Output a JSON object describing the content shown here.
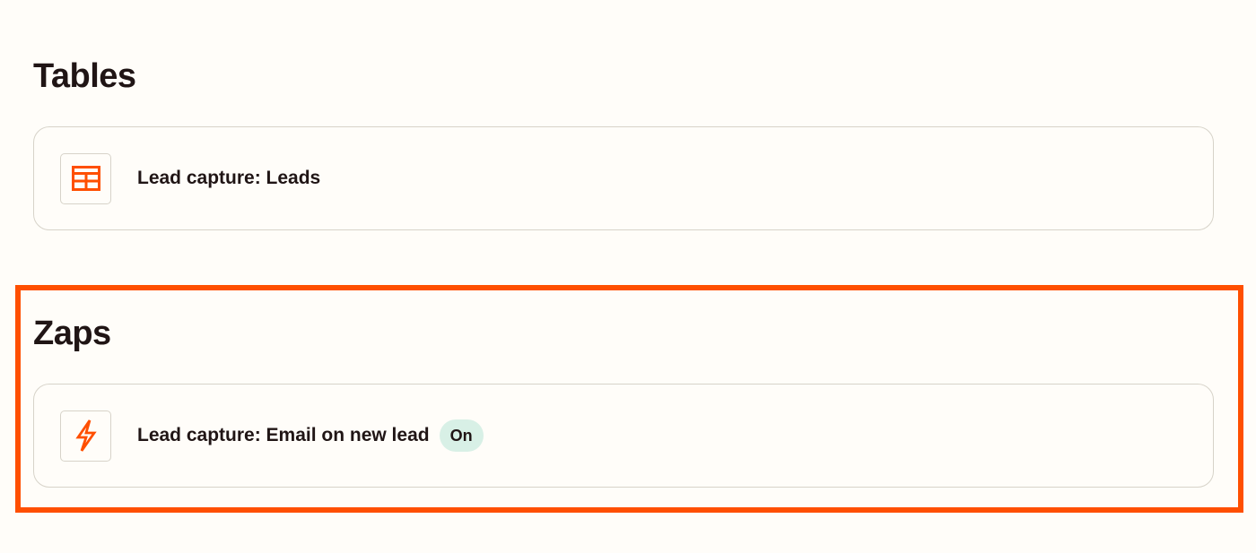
{
  "tables": {
    "title": "Tables",
    "items": [
      {
        "label": "Lead capture: Leads",
        "icon": "table-icon"
      }
    ]
  },
  "zaps": {
    "title": "Zaps",
    "items": [
      {
        "label": "Lead capture: Email on new lead",
        "icon": "lightning-bolt-icon",
        "status": "On"
      }
    ]
  },
  "colors": {
    "accent": "#ff4f00",
    "status_on_bg": "#d8f0e6",
    "border": "#d7d3c9",
    "background": "#fffdf9",
    "text": "#201515"
  }
}
